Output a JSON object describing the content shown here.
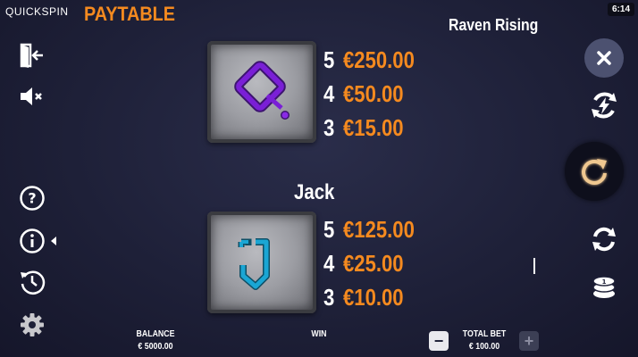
{
  "brand": "QUICKSPIN",
  "header": {
    "title": "PAYTABLE",
    "game_name": "Raven Rising",
    "time": "6:14"
  },
  "symbols": [
    {
      "name": "",
      "icon": "q-rune",
      "color": "#7a1fd6",
      "pays": [
        {
          "count": "5",
          "amount": "€250.00"
        },
        {
          "count": "4",
          "amount": "€50.00"
        },
        {
          "count": "3",
          "amount": "€15.00"
        }
      ]
    },
    {
      "name": "Jack",
      "icon": "j-rune",
      "color": "#1aa6d4",
      "pays": [
        {
          "count": "5",
          "amount": "€125.00"
        },
        {
          "count": "4",
          "amount": "€25.00"
        },
        {
          "count": "3",
          "amount": "€10.00"
        }
      ]
    }
  ],
  "footer": {
    "balance_label": "BALANCE",
    "balance_value": "€ 5000.00",
    "win_label": "WIN",
    "total_bet_label": "TOTAL BET",
    "total_bet_value": "€ 100.00",
    "decrease_label": "−",
    "increase_label": "+"
  },
  "colors": {
    "accent": "#f58a1f",
    "background": "#1e2038"
  },
  "left_controls": [
    "exit-icon",
    "sound-muted-icon",
    "help-icon",
    "info-icon",
    "history-icon",
    "settings-icon"
  ],
  "right_controls": [
    "close-icon",
    "turbo-icon",
    "spin-icon",
    "autoplay-icon",
    "bet-coins-icon"
  ]
}
